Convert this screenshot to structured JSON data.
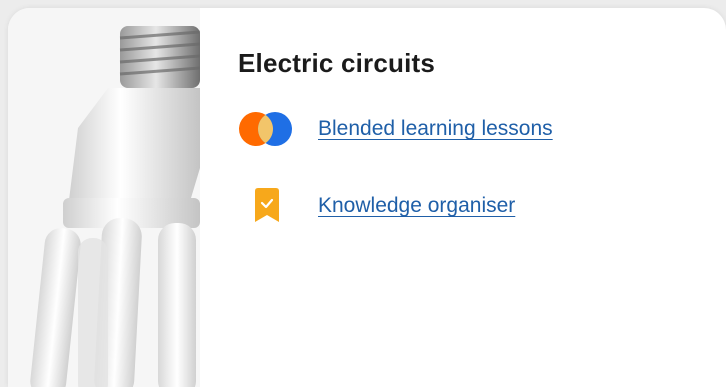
{
  "card": {
    "title": "Electric circuits",
    "image": "light-bulb-photo",
    "links": [
      {
        "label": "Blended learning lessons",
        "icon": "blended-learning-icon"
      },
      {
        "label": "Knowledge organiser",
        "icon": "bookmark-check-icon"
      }
    ]
  },
  "colors": {
    "link": "#1f5fa8",
    "icon_orange": "#ff6a00",
    "icon_blue": "#1f6fe5",
    "bookmark": "#f7a81b"
  }
}
